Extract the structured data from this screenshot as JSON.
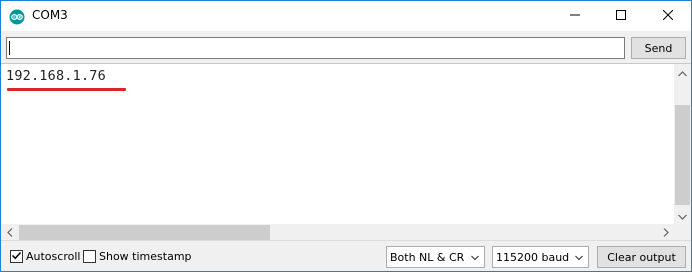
{
  "window": {
    "title": "COM3",
    "accent_color": "#1883d7",
    "icons": {
      "app": "arduino-icon",
      "minimize": "minimize-icon",
      "maximize": "maximize-icon",
      "close": "close-icon"
    }
  },
  "send_bar": {
    "input_value": "",
    "send_label": "Send"
  },
  "output": {
    "text": "192.168.1.76",
    "highlight_color": "#d9262b"
  },
  "bottom_bar": {
    "autoscroll": {
      "label": "Autoscroll",
      "checked": true
    },
    "show_timestamp": {
      "label": "Show timestamp",
      "checked": false
    },
    "line_ending": {
      "selected": "Both NL & CR"
    },
    "baud_rate": {
      "selected": "115200 baud"
    },
    "clear_label": "Clear output"
  }
}
